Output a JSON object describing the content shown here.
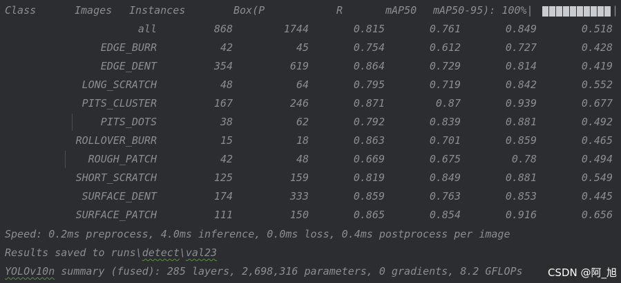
{
  "header": {
    "class": "Class",
    "images": "Images",
    "instances": "Instances",
    "box_p": "Box(P",
    "r": "R",
    "map50": "mAP50",
    "map50_95": "mAP50-95): 100%|",
    "progress_end": "|",
    "progress": 1.0
  },
  "rows": [
    {
      "cls": "all",
      "images": "868",
      "instances": "1744",
      "p": "0.815",
      "r": "0.761",
      "map50": "0.849",
      "map50_95": "0.518"
    },
    {
      "cls": "EDGE_BURR",
      "images": "42",
      "instances": "45",
      "p": "0.754",
      "r": "0.612",
      "map50": "0.727",
      "map50_95": "0.428"
    },
    {
      "cls": "EDGE_DENT",
      "images": "354",
      "instances": "619",
      "p": "0.864",
      "r": "0.729",
      "map50": "0.814",
      "map50_95": "0.419"
    },
    {
      "cls": "LONG_SCRATCH",
      "images": "48",
      "instances": "64",
      "p": "0.795",
      "r": "0.719",
      "map50": "0.842",
      "map50_95": "0.552"
    },
    {
      "cls": "PITS_CLUSTER",
      "images": "167",
      "instances": "246",
      "p": "0.871",
      "r": "0.87",
      "map50": "0.939",
      "map50_95": "0.677"
    },
    {
      "cls": "PITS_DOTS",
      "images": "38",
      "instances": "62",
      "p": "0.792",
      "r": "0.839",
      "map50": "0.881",
      "map50_95": "0.492"
    },
    {
      "cls": "ROLLOVER_BURR",
      "images": "15",
      "instances": "18",
      "p": "0.863",
      "r": "0.701",
      "map50": "0.859",
      "map50_95": "0.465"
    },
    {
      "cls": "ROUGH_PATCH",
      "images": "42",
      "instances": "48",
      "p": "0.669",
      "r": "0.675",
      "map50": "0.78",
      "map50_95": "0.494"
    },
    {
      "cls": "SHORT_SCRATCH",
      "images": "125",
      "instances": "159",
      "p": "0.819",
      "r": "0.849",
      "map50": "0.881",
      "map50_95": "0.549"
    },
    {
      "cls": "SURFACE_DENT",
      "images": "174",
      "instances": "333",
      "p": "0.859",
      "r": "0.763",
      "map50": "0.853",
      "map50_95": "0.445"
    },
    {
      "cls": "SURFACE_PATCH",
      "images": "111",
      "instances": "150",
      "p": "0.865",
      "r": "0.854",
      "map50": "0.916",
      "map50_95": "0.656"
    }
  ],
  "footer": {
    "speed": "Speed: 0.2ms preprocess, 4.0ms inference, 0.0ms loss, 0.4ms postprocess per image",
    "saved_prefix": "Results saved to runs\\",
    "saved_detect": "detect",
    "saved_sep": "\\",
    "saved_val": "val23",
    "summary": "YOLOv10n summary (fused): 285 layers, 2,698,316 parameters, 0 gradients, 8.2 GFLOPs"
  },
  "watermark": "CSDN @阿_旭",
  "colors": {
    "background": "#2b2d30",
    "text": "#8a8d93",
    "progress": "#c9ccd1",
    "squiggle": "#5e8f3e"
  }
}
